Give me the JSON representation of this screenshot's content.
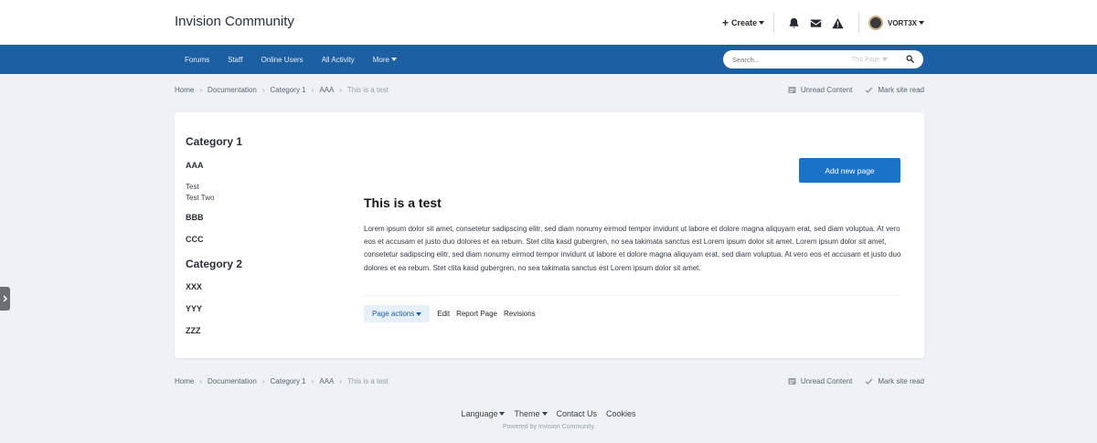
{
  "header": {
    "site_title": "Invision Community",
    "create_label": "Create",
    "username": "VORT3X"
  },
  "nav": {
    "items": [
      "Forums",
      "Staff",
      "Online Users",
      "All Activity",
      "More"
    ],
    "search_placeholder": "Search...",
    "search_scope": "This Page"
  },
  "breadcrumb": {
    "items": [
      "Home",
      "Documentation",
      "Category 1",
      "AAA"
    ],
    "current": "This is a test",
    "unread_label": "Unread Content",
    "mark_read_label": "Mark site read"
  },
  "sidebar": {
    "categories": [
      {
        "title": "Category 1",
        "sections": [
          {
            "title": "AAA",
            "pages": [
              "Test",
              "Test Two"
            ]
          },
          {
            "title": "BBB",
            "pages": []
          },
          {
            "title": "CCC",
            "pages": []
          }
        ]
      },
      {
        "title": "Category 2",
        "sections": [
          {
            "title": "XXX",
            "pages": []
          },
          {
            "title": "YYY",
            "pages": []
          },
          {
            "title": "ZZZ",
            "pages": []
          }
        ]
      }
    ]
  },
  "main": {
    "add_button": "Add new page",
    "title": "This is a test",
    "body": "Lorem ipsum dolor sit amet, consetetur sadipscing elitr, sed diam nonumy eirmod tempor invidunt ut labore et dolore magna aliquyam erat, sed diam voluptua. At vero eos et accusam et justo duo dolores et ea rebum. Stet clita kasd gubergren, no sea takimata sanctus est Lorem ipsum dolor sit amet. Lorem ipsum dolor sit amet, consetetur sadipscing elitr, sed diam nonumy eirmod tempor invidunt ut labore et dolore magna aliquyam erat, sed diam voluptua. At vero eos et accusam et justo duo dolores et ea rebum. Stet clita kasd gubergren, no sea takimata sanctus est Lorem ipsum dolor sit amet.",
    "page_actions_label": "Page actions",
    "edit_label": "Edit",
    "report_label": "Report Page",
    "revisions_label": "Revisions"
  },
  "footer": {
    "language_label": "Language",
    "theme_label": "Theme",
    "contact_label": "Contact Us",
    "cookies_label": "Cookies",
    "powered_by": "Powered by Invision Community"
  },
  "colors": {
    "nav_bg": "#1d5fa3",
    "accent_button": "#1b73c8",
    "page_bg": "#eef1f5"
  },
  "icons": [
    "plus-icon",
    "bell-icon",
    "envelope-icon",
    "warning-icon",
    "search-icon",
    "unread-icon",
    "check-icon",
    "chevron-right-icon"
  ]
}
